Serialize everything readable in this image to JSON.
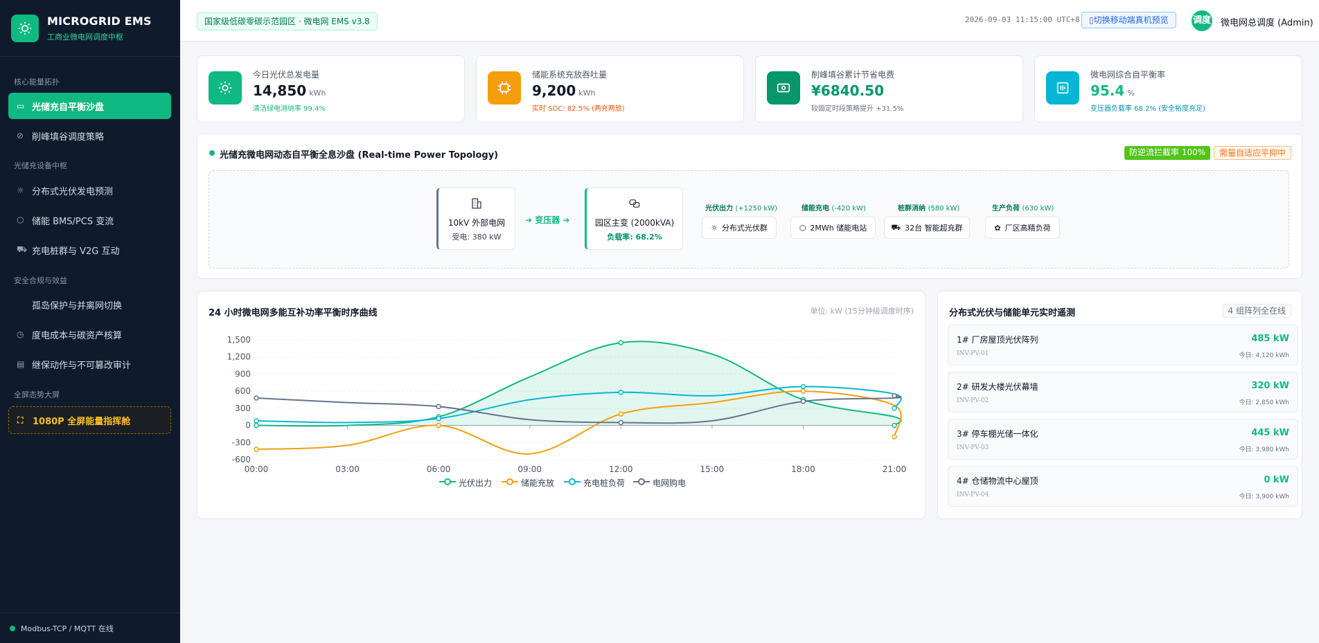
{
  "sidebar": {
    "brand_title": "MICROGRID EMS",
    "brand_sub": "工商业微电网调度中枢",
    "groups": [
      "核心能量拓扑",
      "光储充设备中枢",
      "安全合规与效益",
      "全屏态势大屏"
    ],
    "items": [
      {
        "label": "光储充自平衡沙盘",
        "icon": "monitor-icon"
      },
      {
        "label": "削峰填谷调度策略",
        "icon": "compass-icon"
      },
      {
        "label": "分布式光伏发电预测",
        "icon": "sun-icon"
      },
      {
        "label": "储能 BMS/PCS 变流",
        "icon": "chip-icon"
      },
      {
        "label": "充电桩群与 V2G 互动",
        "icon": "truck-icon"
      },
      {
        "label": "孤岛保护与并离网切换",
        "icon": ""
      },
      {
        "label": "度电成本与碳资产核算",
        "icon": "pie-icon"
      },
      {
        "label": "继保动作与不可篡改审计",
        "icon": "document-icon"
      },
      {
        "label": "1080P 全屏能量指挥舱",
        "icon": "fullscreen-icon"
      }
    ],
    "footer": "Modbus-TCP / MQTT 在线"
  },
  "header": {
    "tag": "国家级低碳零碳示范园区 · 微电网 EMS v3.8",
    "time": "2026-09-03 11:15:00 UTC+8",
    "mobile_btn": "切换移动端真机预览",
    "avatar": "调度",
    "user": "微电网总调度 (Admin)"
  },
  "kpis": [
    {
      "label": "今日光伏总发电量",
      "value": "14,850",
      "unit": "kWh",
      "sub": "清洁绿电消纳率 99.4%",
      "color": "#10b981",
      "sub_color": "#10b981",
      "icon": "sun-icon"
    },
    {
      "label": "储能系统充放吞吐量",
      "value": "9,200",
      "unit": "kWh",
      "sub": "实时 SOC: 82.5% (两充两放)",
      "color": "#f59e0b",
      "sub_color": "#ea580c",
      "icon": "chip-icon"
    },
    {
      "label": "削峰填谷累计节省电费",
      "value": "¥6840.50",
      "unit": "",
      "sub": "较固定时段策略提升 +31.5%",
      "color": "#059669",
      "sub_color": "#6b7280",
      "icon": "money-icon"
    },
    {
      "label": "微电网综合自平衡率",
      "value": "95.4",
      "unit": "%",
      "sub": "变压器负载率 68.2% (安全裕度充足)",
      "color": "#06b6d4",
      "sub_color": "#0891b2",
      "icon": "gauge-icon"
    }
  ],
  "topology": {
    "title": "光储充微电网动态自平衡全息沙盘 (Real-time Power Topology)",
    "pill_green": "防逆流拦截率 100%",
    "pill_orange": "需量自适应平抑中",
    "grid_title": "10kV 外部电网",
    "grid_sub": "受电: 380 kW",
    "arrow": "➔ 变压器 ➔",
    "main_title": "园区主变 (2000kVA)",
    "main_sub": "负载率: 68.2%",
    "branches": [
      {
        "head": "光伏出力",
        "extra": "(+1250 kW)",
        "label": "分布式光伏群",
        "icon": "☼"
      },
      {
        "head": "储能充电",
        "extra": "(-420 kW)",
        "label": "2MWh 储能电站",
        "icon": "⬡"
      },
      {
        "head": "桩群消纳",
        "extra": "(580 kW)",
        "label": "32台 智能超充群",
        "icon": "⛟"
      },
      {
        "head": "生产负荷",
        "extra": "(630 kW)",
        "label": "厂区高精负荷",
        "icon": "✿"
      }
    ]
  },
  "chart_section": {
    "title": "24 小时微电网多能互补功率平衡时序曲线",
    "unit_note": "单位: kW (15分钟级调度时序)"
  },
  "chart_data": {
    "type": "line",
    "x": [
      "00:00",
      "03:00",
      "06:00",
      "09:00",
      "12:00",
      "15:00",
      "18:00",
      "21:00"
    ],
    "x_points": [
      0,
      3,
      6,
      9,
      12,
      15,
      18,
      21,
      22.5
    ],
    "ylim": [
      -600,
      1500
    ],
    "yticks": [
      "1,500",
      "1,200",
      "900",
      "600",
      "300",
      "0",
      "-300",
      "-600"
    ],
    "series": [
      {
        "name": "光伏出力",
        "color": "#10b981",
        "fill": true,
        "values": [
          0,
          0,
          150,
          850,
          1450,
          1250,
          450,
          150,
          0
        ]
      },
      {
        "name": "储能充放",
        "color": "#f59e0b",
        "fill": false,
        "values": [
          -420,
          -350,
          0,
          -500,
          200,
          400,
          600,
          350,
          -200
        ]
      },
      {
        "name": "充电桩负荷",
        "color": "#06b6d4",
        "fill": false,
        "values": [
          80,
          50,
          120,
          450,
          580,
          520,
          680,
          550,
          300
        ]
      },
      {
        "name": "电网购电",
        "color": "#64748b",
        "fill": false,
        "values": [
          480,
          400,
          330,
          100,
          50,
          80,
          420,
          480,
          520
        ]
      }
    ]
  },
  "pv_section": {
    "title": "分布式光伏与储能单元实时遥测",
    "badge": "4 组阵列全在线",
    "rows": [
      {
        "name": "1# 厂房屋顶光伏阵列",
        "id": "INV-PV-01",
        "value": "485 kW",
        "today": "今日: 4,120 kWh"
      },
      {
        "name": "2# 研发大楼光伏幕墙",
        "id": "INV-PV-02",
        "value": "320 kW",
        "today": "今日: 2,850 kWh"
      },
      {
        "name": "3# 停车棚光储一体化",
        "id": "INV-PV-03",
        "value": "445 kW",
        "today": "今日: 3,980 kWh"
      },
      {
        "name": "4# 仓储物流中心屋顶",
        "id": "INV-PV-04",
        "value": "0 kW",
        "today": "今日: 3,900 kWh"
      }
    ]
  }
}
